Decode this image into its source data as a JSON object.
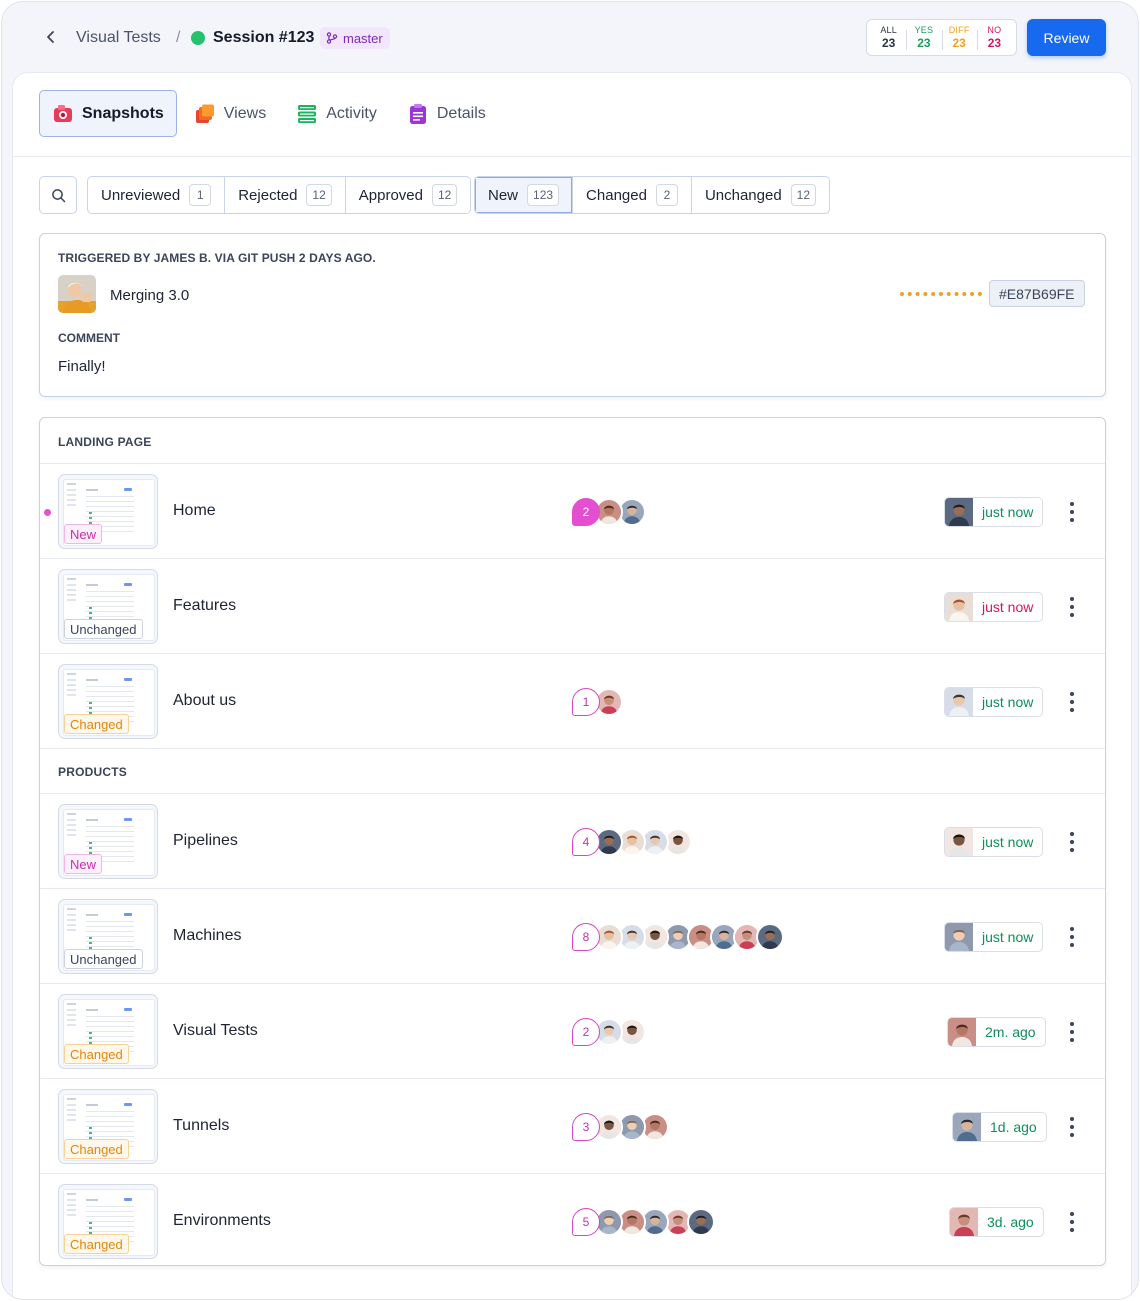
{
  "header": {
    "breadcrumb_root": "Visual Tests",
    "breadcrumb_sep": "/",
    "session_title": "Session #123",
    "branch": "master",
    "counts": [
      {
        "key": "ALL",
        "value": "23",
        "color": "#2b3347"
      },
      {
        "key": "YES",
        "value": "23",
        "color": "#18a05d"
      },
      {
        "key": "DIFF",
        "value": "23",
        "color": "#f0a316"
      },
      {
        "key": "NO",
        "value": "23",
        "color": "#d8155c"
      }
    ],
    "review_label": "Review"
  },
  "tabs": [
    {
      "label": "Snapshots",
      "icon": "camera-icon",
      "active": true
    },
    {
      "label": "Views",
      "icon": "layers-icon",
      "active": false
    },
    {
      "label": "Activity",
      "icon": "database-icon",
      "active": false
    },
    {
      "label": "Details",
      "icon": "clipboard-icon",
      "active": false
    }
  ],
  "filters": {
    "review": [
      {
        "label": "Unreviewed",
        "count": "1"
      },
      {
        "label": "Rejected",
        "count": "12"
      },
      {
        "label": "Approved",
        "count": "12"
      }
    ],
    "state": [
      {
        "label": "New",
        "count": "123",
        "active": true
      },
      {
        "label": "Changed",
        "count": "2"
      },
      {
        "label": "Unchanged",
        "count": "12"
      }
    ]
  },
  "info": {
    "trigger": "TRIGGERED BY JAMES B. VIA GIT PUSH 2 DAYS AGO.",
    "commit_message": "Merging 3.0",
    "hash": "#E87B69FE",
    "comment_label": "COMMENT",
    "comment": "Finally!"
  },
  "sections": [
    {
      "title": "LANDING PAGE",
      "rows": [
        {
          "name": "Home",
          "badge": "New",
          "state": "new",
          "unread": true,
          "count": "2",
          "count_style": "filled",
          "avatars": 2,
          "time": "just now",
          "time_tone": "ok"
        },
        {
          "name": "Features",
          "badge": "Unchanged",
          "state": "unchanged",
          "count": "",
          "avatars": 0,
          "time": "just now",
          "time_tone": "warn"
        },
        {
          "name": "About us",
          "badge": "Changed",
          "state": "changed",
          "count": "1",
          "count_style": "outline",
          "avatars": 1,
          "time": "just now",
          "time_tone": "ok"
        }
      ]
    },
    {
      "title": "PRODUCTS",
      "rows": [
        {
          "name": "Pipelines",
          "badge": "New",
          "state": "new",
          "count": "4",
          "count_style": "outline",
          "avatars": 4,
          "time": "just now",
          "time_tone": "ok"
        },
        {
          "name": "Machines",
          "badge": "Unchanged",
          "state": "unchanged",
          "count": "8",
          "count_style": "outline",
          "avatars": 8,
          "time": "just now",
          "time_tone": "ok"
        },
        {
          "name": "Visual Tests",
          "badge": "Changed",
          "state": "changed",
          "count": "2",
          "count_style": "outline",
          "avatars": 2,
          "time": "2m. ago",
          "time_tone": "ok"
        },
        {
          "name": "Tunnels",
          "badge": "Changed",
          "state": "changed",
          "count": "3",
          "count_style": "outline",
          "avatars": 3,
          "time": "1d. ago",
          "time_tone": "ok"
        },
        {
          "name": "Environments",
          "badge": "Changed",
          "state": "changed",
          "count": "5",
          "count_style": "outline",
          "avatars": 5,
          "time": "3d. ago",
          "time_tone": "ok"
        }
      ]
    }
  ]
}
